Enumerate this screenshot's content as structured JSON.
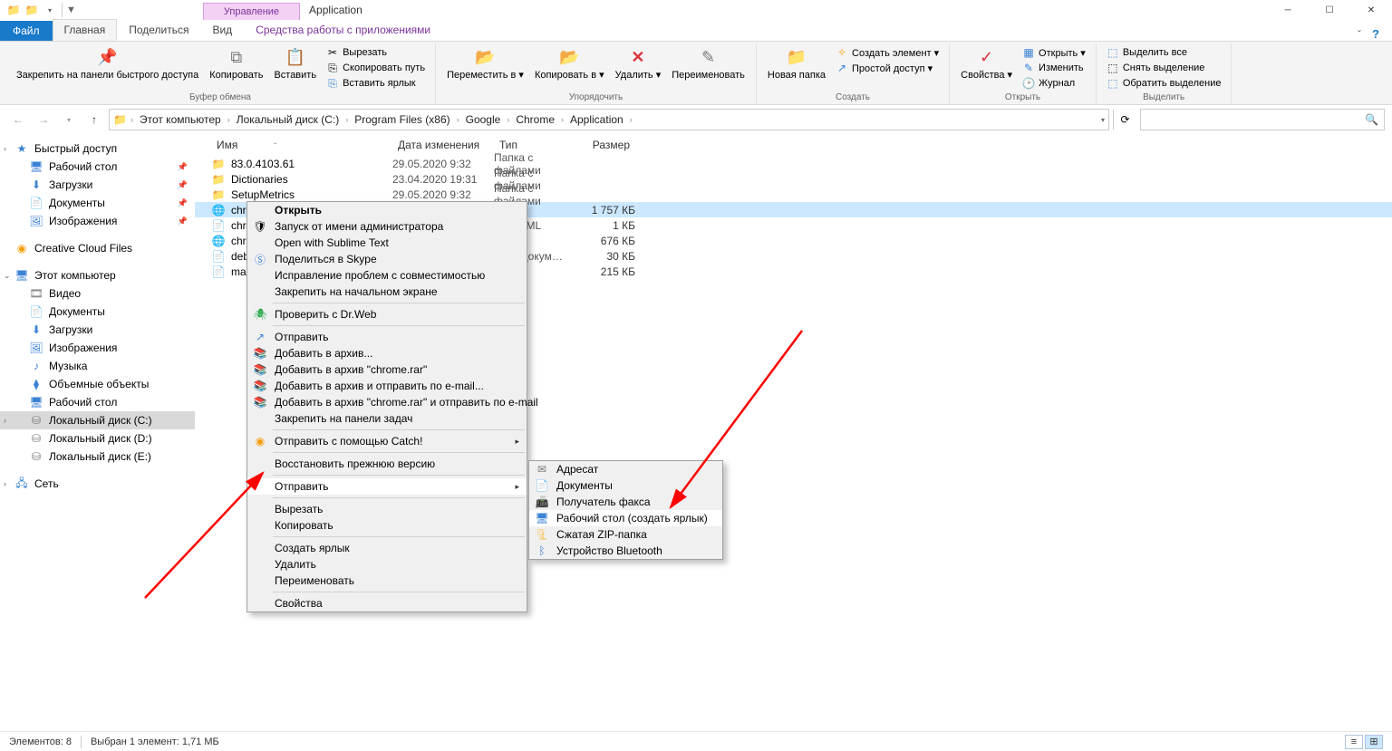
{
  "window": {
    "title": "Application"
  },
  "title_tabs": {
    "manage": "Управление"
  },
  "tabs": {
    "file": "Файл",
    "home": "Главная",
    "share": "Поделиться",
    "view": "Вид",
    "app_tools": "Средства работы с приложениями"
  },
  "ribbon": {
    "clipboard": {
      "pin": "Закрепить на панели\nбыстрого доступа",
      "copy": "Копировать",
      "paste": "Вставить",
      "cut": "Вырезать",
      "copy_path": "Скопировать путь",
      "paste_shortcut": "Вставить ярлык",
      "label": "Буфер обмена"
    },
    "organize": {
      "move_to": "Переместить\nв ▾",
      "copy_to": "Копировать\nв ▾",
      "delete": "Удалить\n▾",
      "rename": "Переименовать",
      "label": "Упорядочить"
    },
    "new": {
      "new_folder": "Новая\nпапка",
      "new_item": "Создать элемент ▾",
      "easy_access": "Простой доступ ▾",
      "label": "Создать"
    },
    "open": {
      "properties": "Свойства\n▾",
      "open": "Открыть ▾",
      "edit": "Изменить",
      "history": "Журнал",
      "label": "Открыть"
    },
    "select": {
      "select_all": "Выделить все",
      "select_none": "Снять выделение",
      "invert": "Обратить выделение",
      "label": "Выделить"
    }
  },
  "breadcrumbs": [
    "Этот компьютер",
    "Локальный диск (C:)",
    "Program Files (x86)",
    "Google",
    "Chrome",
    "Application"
  ],
  "search_placeholder": "",
  "columns": {
    "name": "Имя",
    "date": "Дата изменения",
    "type": "Тип",
    "size": "Размер"
  },
  "files": [
    {
      "icon": "folder",
      "name": "83.0.4103.61",
      "date": "29.05.2020 9:32",
      "type": "Папка с файлами",
      "size": ""
    },
    {
      "icon": "folder",
      "name": "Dictionaries",
      "date": "23.04.2020 19:31",
      "type": "Папка с файлами",
      "size": ""
    },
    {
      "icon": "folder",
      "name": "SetupMetrics",
      "date": "29.05.2020 9:32",
      "type": "Папка с файлами",
      "size": ""
    },
    {
      "icon": "chrome",
      "name": "chro",
      "date": "",
      "type": "…ние",
      "size": "1 757 КБ",
      "selected": true
    },
    {
      "icon": "file",
      "name": "chro",
      "date": "",
      "type": "…нт XML",
      "size": "1 КБ"
    },
    {
      "icon": "chrome",
      "name": "chro",
      "date": "",
      "type": "…ние",
      "size": "676 КБ"
    },
    {
      "icon": "file",
      "name": "deb…",
      "date": "",
      "type": "…ый докум…",
      "size": "30 КБ"
    },
    {
      "icon": "file",
      "name": "mas…",
      "date": "",
      "type": "",
      "size": "215 КБ"
    }
  ],
  "nav": {
    "quick_access": "Быстрый доступ",
    "desktop": "Рабочий стол",
    "downloads": "Загрузки",
    "documents": "Документы",
    "pictures": "Изображения",
    "creative_cloud": "Creative Cloud Files",
    "this_pc": "Этот компьютер",
    "videos": "Видео",
    "documents2": "Документы",
    "downloads2": "Загрузки",
    "pictures2": "Изображения",
    "music": "Музыка",
    "objects3d": "Объемные объекты",
    "desktop2": "Рабочий стол",
    "disk_c": "Локальный диск (C:)",
    "disk_d": "Локальный диск (D:)",
    "disk_e": "Локальный диск (E:)",
    "network": "Сеть"
  },
  "context": {
    "open": "Открыть",
    "run_as_admin": "Запуск от имени администратора",
    "open_with_sublime": "Open with Sublime Text",
    "share_skype": "Поделиться в Skype",
    "compat_troubleshoot": "Исправление проблем с совместимостью",
    "pin_start": "Закрепить на начальном экране",
    "drweb": "Проверить с Dr.Web",
    "send": "Отправить",
    "add_archive": "Добавить в архив...",
    "add_archive_chrome": "Добавить в архив \"chrome.rar\"",
    "add_archive_email": "Добавить в архив и отправить по e-mail...",
    "add_archive_chrome_email": "Добавить в архив \"chrome.rar\" и отправить по e-mail",
    "pin_taskbar": "Закрепить на панели задач",
    "send_catch": "Отправить с помощью Catch!",
    "restore_prev": "Восстановить прежнюю версию",
    "send_to": "Отправить",
    "cut": "Вырезать",
    "copy": "Копировать",
    "create_shortcut": "Создать ярлык",
    "delete": "Удалить",
    "rename": "Переименовать",
    "properties": "Свойства"
  },
  "submenu": {
    "recipient": "Адресат",
    "documents": "Документы",
    "fax": "Получатель факса",
    "desktop_shortcut": "Рабочий стол (создать ярлык)",
    "zip": "Сжатая ZIP-папка",
    "bluetooth": "Устройство Bluetooth"
  },
  "status": {
    "count": "Элементов: 8",
    "selected": "Выбран 1 элемент: 1,71 МБ"
  }
}
